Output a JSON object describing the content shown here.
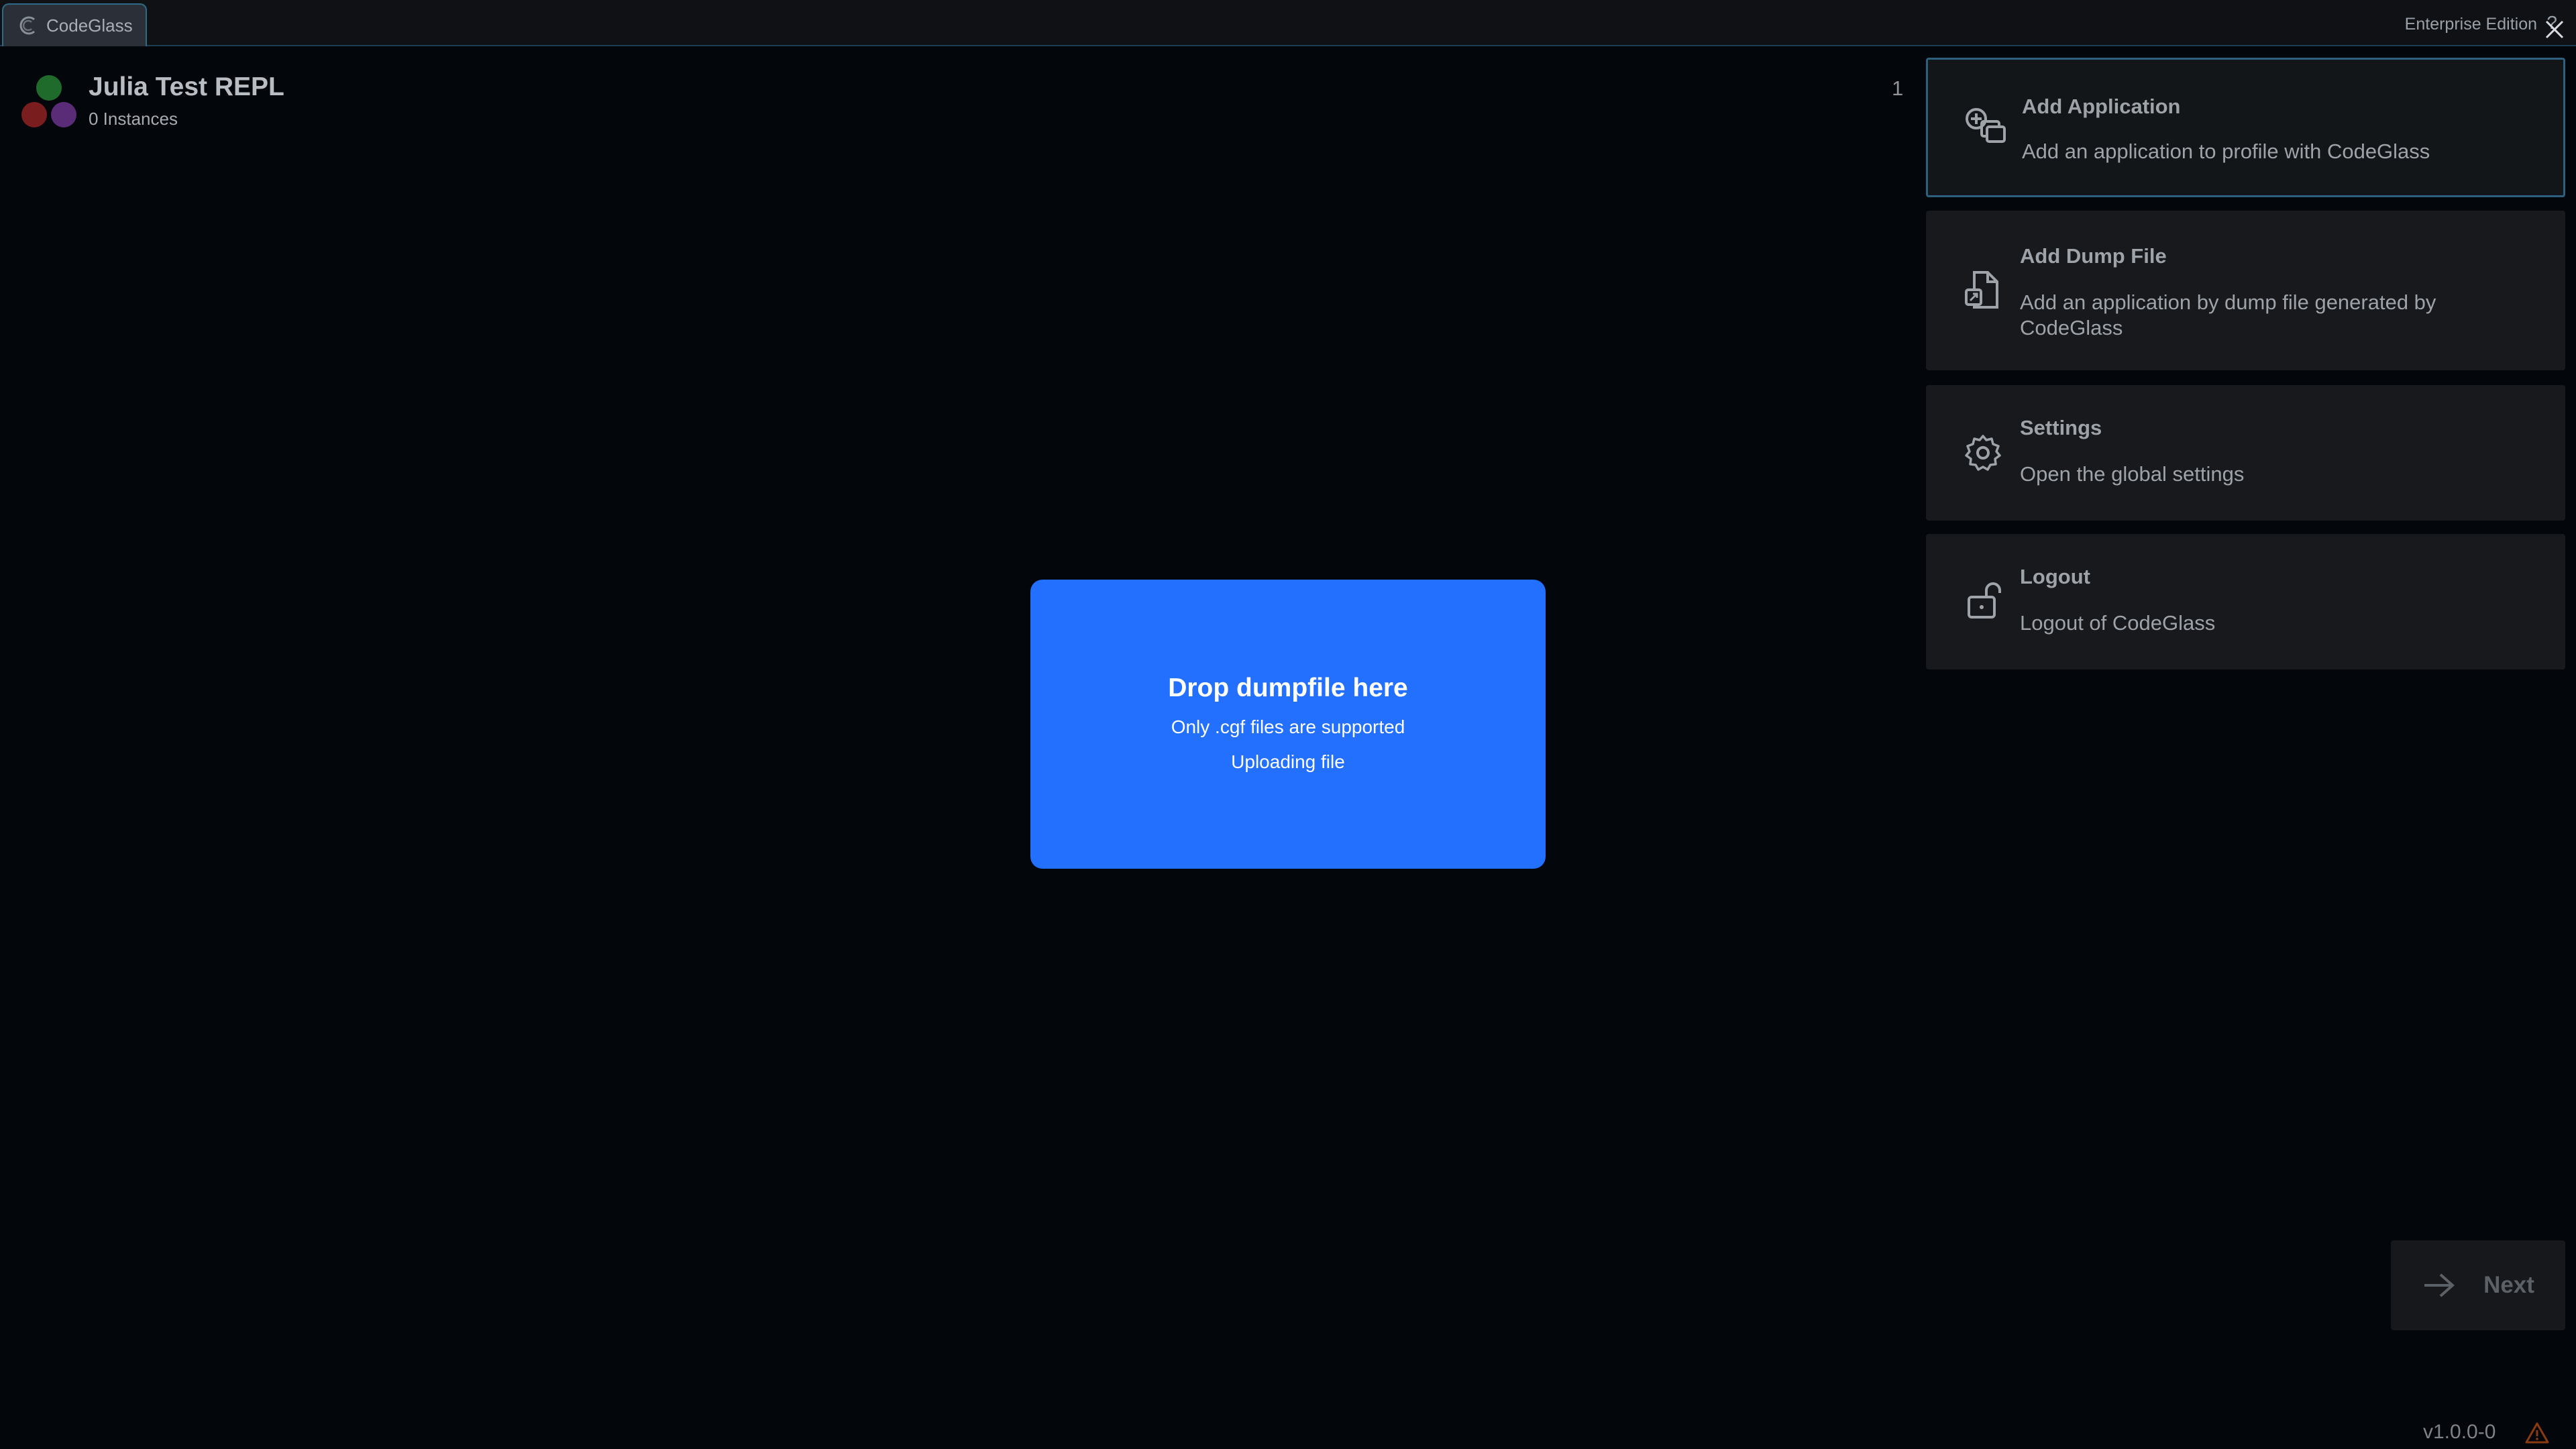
{
  "titlebar": {
    "app_tab_label": "CodeGlass",
    "edition": "Enterprise Edition",
    "help_glyph": "?"
  },
  "project": {
    "title": "Julia Test REPL",
    "subtitle": "0 Instances",
    "count": "1",
    "dot_colors": [
      "#1f6b2c",
      "#7a1d1f",
      "#5a2c77"
    ]
  },
  "actions": [
    {
      "icon": "add-application-icon",
      "title": "Add Application",
      "description": "Add an application to profile with CodeGlass",
      "selected": true
    },
    {
      "icon": "dump-file-icon",
      "title": "Add Dump File",
      "description": "Add an application by dump file generated by CodeGlass",
      "selected": false
    },
    {
      "icon": "gear-icon",
      "title": "Settings",
      "description": "Open the global settings",
      "selected": false
    },
    {
      "icon": "unlock-icon",
      "title": "Logout",
      "description": "Logout of CodeGlass",
      "selected": false
    }
  ],
  "dropzone": {
    "title": "Drop dumpfile here",
    "subtitle": "Only .cgf files are supported",
    "status": "Uploading file",
    "color": "#2270fd"
  },
  "next_button": {
    "label": "Next"
  },
  "footer": {
    "version": "v1.0.0-0"
  },
  "colors": {
    "background": "#03060b",
    "accent_border": "#2e6b86",
    "card": "#17191c",
    "warning": "#8a3a10"
  }
}
